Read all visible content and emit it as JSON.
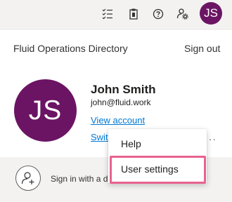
{
  "colors": {
    "accent": "#6b1464",
    "highlight": "#e8628f",
    "link": "#0078d4"
  },
  "topbar": {
    "icons": [
      "checklist-icon",
      "clipboard-icon",
      "help-icon",
      "settings-people-icon"
    ],
    "avatar_initials": "JS"
  },
  "panel": {
    "org_name": "Fluid Operations Directory",
    "sign_out": "Sign out",
    "avatar_initials": "JS",
    "user_name": "John Smith",
    "user_email": "john@fluid.work",
    "view_account": "View account",
    "switch_directory_partial": "Switc",
    "more": "···"
  },
  "footer": {
    "sign_in_text_partial": "Sign in with a d"
  },
  "menu": {
    "items": [
      "Help",
      "User settings"
    ]
  }
}
